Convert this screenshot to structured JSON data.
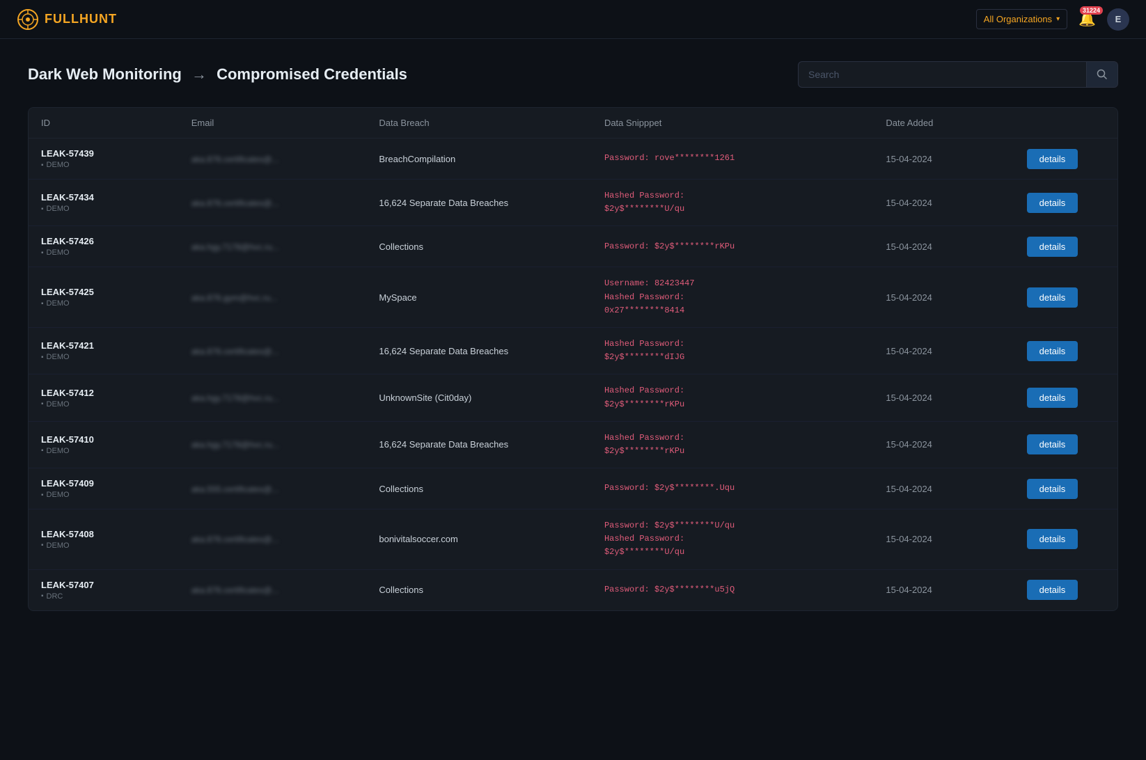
{
  "app": {
    "name": "FULLHUNT",
    "logo_char": "🎯"
  },
  "topnav": {
    "org_selector_label": "All Organizations",
    "notif_count": "31224",
    "user_initial": "E"
  },
  "page": {
    "title_part1": "Dark Web Monitoring",
    "title_arrow": "→",
    "title_part2": "Compromised Credentials",
    "search_placeholder": "Search"
  },
  "table": {
    "columns": [
      "ID",
      "Email",
      "Data Breach",
      "Data Snipppet",
      "Date Added",
      ""
    ],
    "rows": [
      {
        "id": "LEAK-57439",
        "tag": "DEMO",
        "email": "aka.876.certificates@...",
        "breach": "BreachCompilation",
        "snippet": "Password: rove********1261",
        "date": "15-04-2024"
      },
      {
        "id": "LEAK-57434",
        "tag": "DEMO",
        "email": "aka.876.certificates@...",
        "breach": "16,624 Separate Data Breaches",
        "snippet": "Hashed Password:\n$2y$********U/qu",
        "date": "15-04-2024"
      },
      {
        "id": "LEAK-57426",
        "tag": "DEMO",
        "email": "aka.hgy.7178@hvc.ru...",
        "breach": "Collections",
        "snippet": "Password: $2y$********rKPu",
        "date": "15-04-2024"
      },
      {
        "id": "LEAK-57425",
        "tag": "DEMO",
        "email": "aka.876.gym@hvc.ru...",
        "breach": "MySpace",
        "snippet": "Username: 82423447\nHashed Password:\n0x27********8414",
        "date": "15-04-2024"
      },
      {
        "id": "LEAK-57421",
        "tag": "DEMO",
        "email": "aka.876.certificates@...",
        "breach": "16,624 Separate Data Breaches",
        "snippet": "Hashed Password:\n$2y$********dIJG",
        "date": "15-04-2024"
      },
      {
        "id": "LEAK-57412",
        "tag": "DEMO",
        "email": "aka.hgy.7178@hvc.ru...",
        "breach": "UnknownSite (Cit0day)",
        "snippet": "Hashed Password:\n$2y$********rKPu",
        "date": "15-04-2024"
      },
      {
        "id": "LEAK-57410",
        "tag": "DEMO",
        "email": "aka.hgy.7178@hvc.ru...",
        "breach": "16,624 Separate Data Breaches",
        "snippet": "Hashed Password:\n$2y$********rKPu",
        "date": "15-04-2024"
      },
      {
        "id": "LEAK-57409",
        "tag": "DEMO",
        "email": "aka.555.certificates@...",
        "breach": "Collections",
        "snippet": "Password: $2y$********.Uqu",
        "date": "15-04-2024"
      },
      {
        "id": "LEAK-57408",
        "tag": "DEMO",
        "email": "aka.876.certificates@...",
        "breach": "bonivitalsoccer.com",
        "snippet": "Password: $2y$********U/qu\nHashed Password:\n$2y$********U/qu",
        "date": "15-04-2024"
      },
      {
        "id": "LEAK-57407",
        "tag": "DRC",
        "email": "aka.876.certificates@...",
        "breach": "Collections",
        "snippet": "Password: $2y$********u5jQ",
        "date": "15-04-2024"
      }
    ],
    "details_label": "details"
  }
}
